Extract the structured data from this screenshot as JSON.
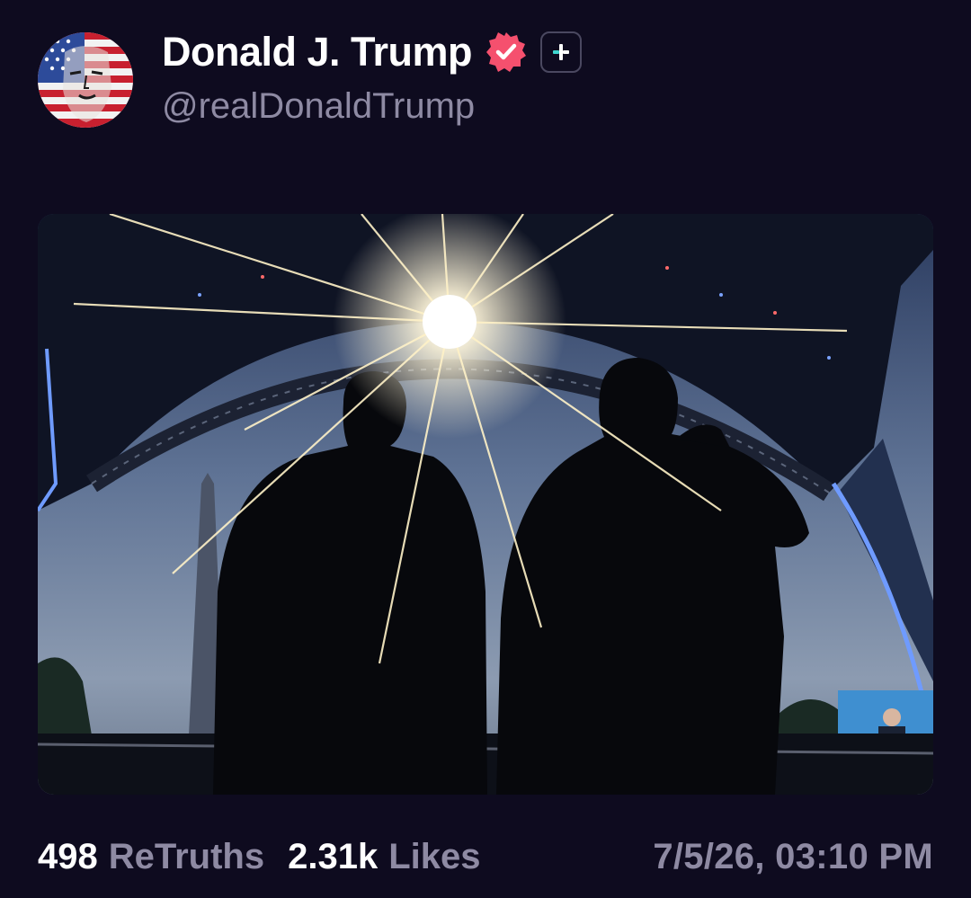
{
  "post": {
    "author": {
      "display_name": "Donald J. Trump",
      "handle": "@realDonaldTrump",
      "verified_color": "#f5506e"
    },
    "image": {
      "description_icon": "photo-image"
    },
    "stats": {
      "retruths_count": "498",
      "retruths_label": "ReTruths",
      "likes_count": "2.31k",
      "likes_label": "Likes"
    },
    "timestamp": "7/5/26, 03:10 PM"
  },
  "colors": {
    "background": "#0e0b1f",
    "primary_text": "#ffffff",
    "secondary_text": "#8e8aa3"
  }
}
